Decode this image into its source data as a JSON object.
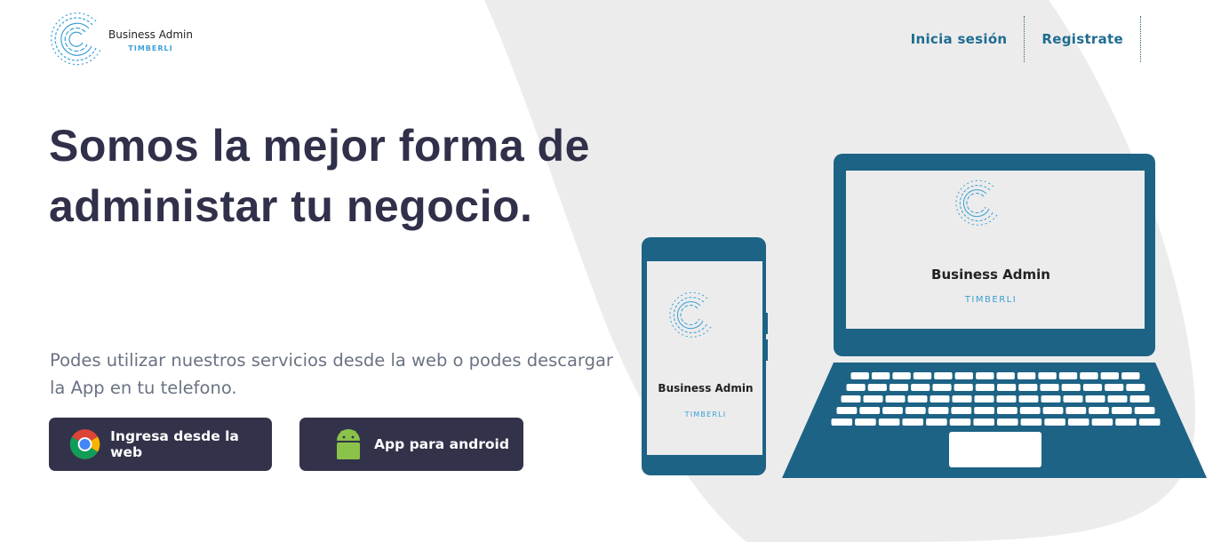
{
  "brand": {
    "name": "Business Admin",
    "sub": "TIMBERLI"
  },
  "nav": {
    "login": "Inicia sesión",
    "register": "Registrate"
  },
  "hero": {
    "title": "Somos la mejor forma de administar tu negocio.",
    "subtitle": "Podes utilizar nuestros servicios desde la web o podes descargar la App en tu telefono."
  },
  "buttons": {
    "web": {
      "label": "Ingresa desde la web",
      "icon": "chrome-icon"
    },
    "android": {
      "label": "App para android",
      "icon": "android-icon"
    }
  },
  "devices": {
    "laptop_brand": "Business Admin",
    "laptop_sub": "TIMBERLI",
    "phone_brand": "Business Admin",
    "phone_sub": "TIMBERLI"
  },
  "colors": {
    "device": "#1d6385",
    "dark": "#32334a",
    "link": "#1f6d92",
    "accent": "#3aa0d6",
    "blob": "#ececec"
  }
}
